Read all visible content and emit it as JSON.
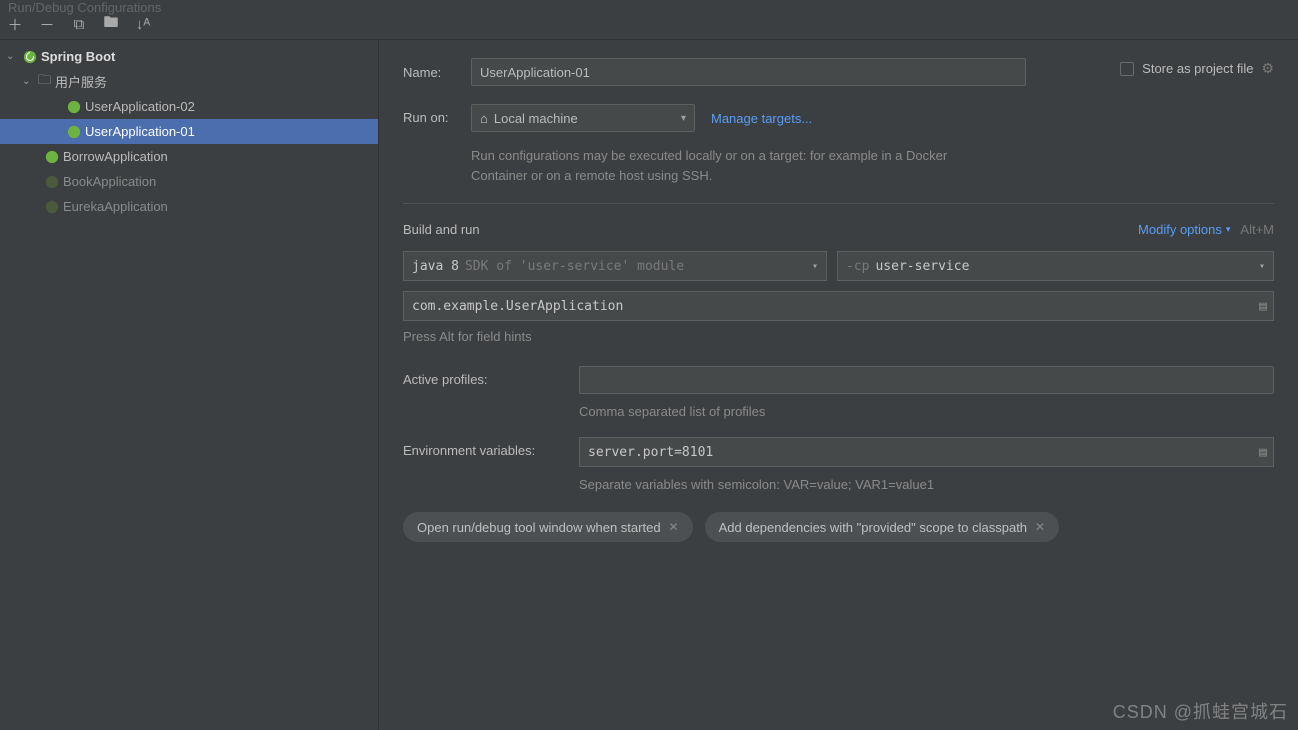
{
  "titlebar": {
    "title": "Run/Debug Configurations"
  },
  "tree": {
    "root": "Spring Boot",
    "folder": "用户服务",
    "items": [
      "UserApplication-02",
      "UserApplication-01"
    ],
    "selected": "UserApplication-01",
    "leaves": [
      "BorrowApplication",
      "BookApplication",
      "EurekaApplication"
    ]
  },
  "form": {
    "name_label": "Name:",
    "name_value": "UserApplication-01",
    "store_label": "Store as project file",
    "runon_label": "Run on:",
    "runon_value": "Local machine",
    "manage_targets": "Manage targets...",
    "runon_hint": "Run configurations may be executed locally or on a target: for example in a Docker Container or on a remote host using SSH.",
    "build_section": "Build and run",
    "modify_options": "Modify options",
    "modify_shortcut": "Alt+M",
    "jdk_main": "java 8",
    "jdk_hint": "SDK of 'user-service' module",
    "cp_prefix": "-cp",
    "cp_value": "user-service",
    "main_class": "com.example.UserApplication",
    "press_hint": "Press Alt for field hints",
    "profiles_label": "Active profiles:",
    "profiles_hint": "Comma separated list of profiles",
    "env_label": "Environment variables:",
    "env_value": "server.port=8101",
    "env_hint": "Separate variables with semicolon: VAR=value; VAR1=value1",
    "chip1": "Open run/debug tool window when started",
    "chip2": "Add dependencies with \"provided\" scope to classpath"
  },
  "watermark": "CSDN @抓蛙宫城石"
}
